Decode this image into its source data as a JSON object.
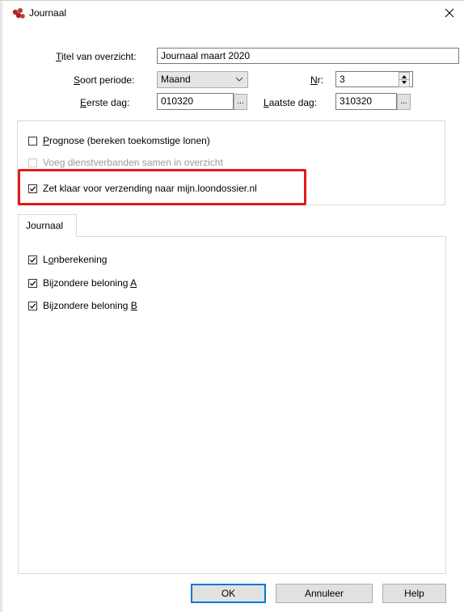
{
  "window": {
    "title": "Journaal",
    "app_icon": "program-logo-icon",
    "close_icon": "close-icon"
  },
  "form": {
    "titel": {
      "label": "Titel van overzicht:",
      "mnemonic": "T",
      "label_rest": "itel van overzicht:",
      "value": "Journaal maart 2020"
    },
    "soort_periode": {
      "mnemonic": "S",
      "label_rest": "oort periode:",
      "value": "Maand"
    },
    "nr": {
      "mnemonic": "N",
      "label_rest": "r:",
      "value": "3"
    },
    "eerste_dag": {
      "mnemonic": "E",
      "label_rest": "erste dag:",
      "value": "010320",
      "button": "..."
    },
    "laatste_dag": {
      "mnemonic": "L",
      "label_rest": "aatste dag:",
      "value": "310320",
      "button": "..."
    }
  },
  "options": [
    {
      "mnemonic": "P",
      "label_rest": "rognose (bereken toekomstige lonen)",
      "checked": false,
      "enabled": true
    },
    {
      "label": "Voeg dienstverbanden samen in overzicht",
      "checked": false,
      "enabled": false
    },
    {
      "label": "Zet klaar voor verzending naar mijn.loondossier.nl",
      "checked": true,
      "enabled": true,
      "highlight_color": "#e11b1b"
    }
  ],
  "tab": {
    "label": "Journaal",
    "items": [
      {
        "mnemonic": "o",
        "prefix": "L",
        "label_rest": "nberekening",
        "checked": true
      },
      {
        "prefix": "Bijzondere beloning ",
        "mnemonic": "A",
        "label_rest": "",
        "checked": true
      },
      {
        "prefix": "Bijzondere beloning ",
        "mnemonic": "B",
        "label_rest": "",
        "checked": true
      }
    ]
  },
  "buttons": {
    "ok": "OK",
    "cancel": "Annuleer",
    "help": "Help"
  },
  "colors": {
    "accent": "#0078d7",
    "highlight": "#e11b1b"
  }
}
